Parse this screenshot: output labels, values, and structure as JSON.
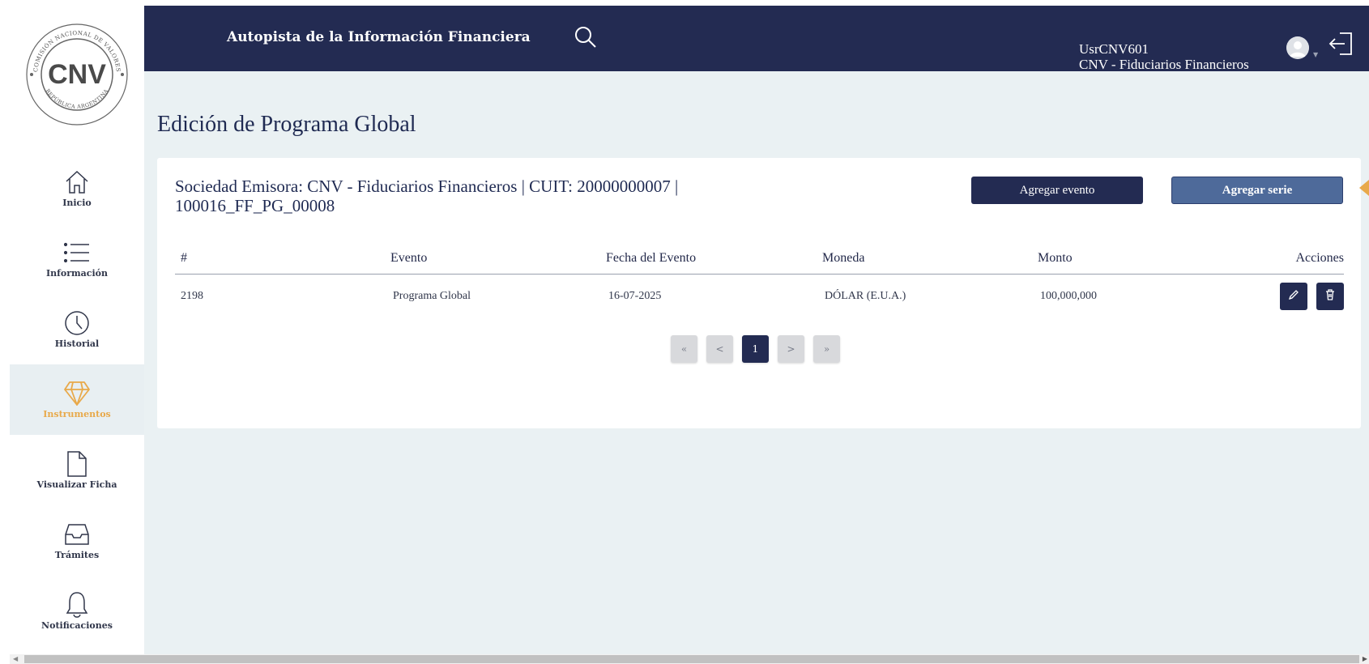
{
  "header": {
    "app_title": "Autopista de la Información Financiera",
    "user_name": "UsrCNV601",
    "user_org": "CNV - Fiduciarios Financieros"
  },
  "logo": {
    "acronym": "CNV",
    "ring_top": "COMISIÓN NACIONAL DE VALORES",
    "ring_bottom": "REPÚBLICA ARGENTINA"
  },
  "sidebar": {
    "items": [
      {
        "label": "Inicio",
        "icon": "home-icon"
      },
      {
        "label": "Información",
        "icon": "list-icon"
      },
      {
        "label": "Historial",
        "icon": "clock-icon"
      },
      {
        "label": "Instrumentos",
        "icon": "diamond-icon",
        "active": true
      },
      {
        "label": "Visualizar Ficha",
        "icon": "file-icon"
      },
      {
        "label": "Trámites",
        "icon": "inbox-icon"
      },
      {
        "label": "Notificaciones",
        "icon": "bell-icon"
      }
    ]
  },
  "page": {
    "title": "Edición de Programa Global"
  },
  "card": {
    "heading_line1": "Sociedad Emisora: CNV - Fiduciarios Financieros | CUIT: 20000000007 |",
    "heading_line2": "100016_FF_PG_00008",
    "btn_agregar_evento": "Agregar evento",
    "btn_agregar_serie": "Agregar serie"
  },
  "table": {
    "headers": [
      "#",
      "Evento",
      "Fecha del Evento",
      "Moneda",
      "Monto",
      "Acciones"
    ],
    "rows": [
      {
        "id": "2198",
        "evento": "Programa Global",
        "fecha": "16-07-2025",
        "moneda": "DÓLAR (E.U.A.)",
        "monto": "100,000,000"
      }
    ]
  },
  "pagination": {
    "first": "«",
    "prev": "<",
    "current": "1",
    "next": ">",
    "last": "»"
  },
  "colors": {
    "navy": "#232b52",
    "accent": "#e8a94a",
    "background": "#eaf1f3",
    "serie_button": "#4e6a9a"
  }
}
